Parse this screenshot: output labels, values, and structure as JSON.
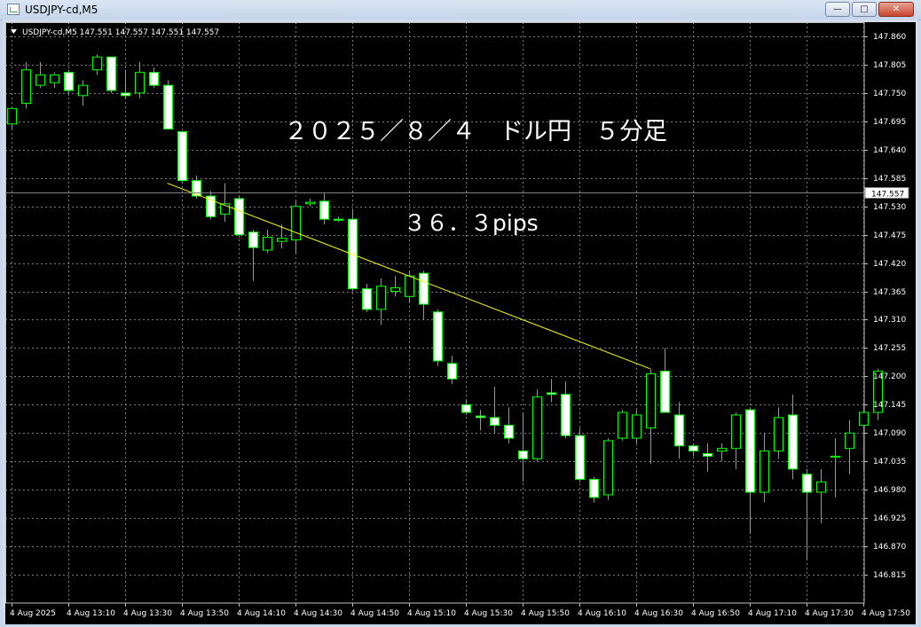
{
  "window": {
    "title": "USDJPY-cd,M5",
    "minimize_glyph": "—",
    "maximize_glyph": "□",
    "close_glyph": "✕"
  },
  "chart_header": "USDJPY-cd,M5  147.551 147.557 147.551 147.557",
  "colors": {
    "background": "#000000",
    "grid": "#7a7a7a",
    "axis_text": "#ffffff",
    "bull_candle_body": "#000000",
    "bull_candle_border": "#00ff00",
    "bear_candle_body": "#ffffff",
    "wick": "#00ff00",
    "trendline": "#ffff00",
    "bid_line": "#808080"
  },
  "annotation": {
    "title": "２０２５／８／４　ドル円　５分足",
    "pips": "３６．３pips"
  },
  "chart_data": {
    "type": "candlestick",
    "symbol": "USDJPY-cd",
    "timeframe": "M5",
    "grid": true,
    "ylim": [
      146.79,
      147.875
    ],
    "y_ticks": [
      "147.860",
      "147.805",
      "147.750",
      "147.695",
      "147.640",
      "147.585",
      "147.530",
      "147.475",
      "147.420",
      "147.365",
      "147.310",
      "147.255",
      "147.200",
      "147.145",
      "147.090",
      "147.035",
      "146.980",
      "146.925",
      "146.870",
      "146.815"
    ],
    "x_tick_labels": [
      "4 Aug 2025",
      "4 Aug 13:10",
      "4 Aug 13:30",
      "4 Aug 13:50",
      "4 Aug 14:10",
      "4 Aug 14:30",
      "4 Aug 14:50",
      "4 Aug 15:10",
      "4 Aug 15:30",
      "4 Aug 15:50",
      "4 Aug 16:10",
      "4 Aug 16:30",
      "4 Aug 16:50",
      "4 Aug 17:10",
      "4 Aug 17:30",
      "4 Aug 17:50"
    ],
    "current_price": "147.557",
    "trendline": {
      "from": [
        11,
        147.575
      ],
      "to": [
        45,
        147.215
      ]
    },
    "candles": [
      {
        "o": 147.69,
        "h": 147.72,
        "l": 147.68,
        "c": 147.72
      },
      {
        "o": 147.73,
        "h": 147.81,
        "l": 147.72,
        "c": 147.795
      },
      {
        "o": 147.765,
        "h": 147.81,
        "l": 147.76,
        "c": 147.785
      },
      {
        "o": 147.77,
        "h": 147.79,
        "l": 147.76,
        "c": 147.785
      },
      {
        "o": 147.79,
        "h": 147.795,
        "l": 147.745,
        "c": 147.755
      },
      {
        "o": 147.745,
        "h": 147.775,
        "l": 147.725,
        "c": 147.765
      },
      {
        "o": 147.795,
        "h": 147.825,
        "l": 147.785,
        "c": 147.82
      },
      {
        "o": 147.82,
        "h": 147.82,
        "l": 147.75,
        "c": 147.755
      },
      {
        "o": 147.75,
        "h": 147.795,
        "l": 147.74,
        "c": 147.745
      },
      {
        "o": 147.75,
        "h": 147.81,
        "l": 147.74,
        "c": 147.79
      },
      {
        "o": 147.79,
        "h": 147.8,
        "l": 147.76,
        "c": 147.765
      },
      {
        "o": 147.765,
        "h": 147.775,
        "l": 147.68,
        "c": 147.68
      },
      {
        "o": 147.675,
        "h": 147.675,
        "l": 147.575,
        "c": 147.58
      },
      {
        "o": 147.58,
        "h": 147.59,
        "l": 147.545,
        "c": 147.55
      },
      {
        "o": 147.55,
        "h": 147.56,
        "l": 147.505,
        "c": 147.51
      },
      {
        "o": 147.515,
        "h": 147.575,
        "l": 147.5,
        "c": 147.535
      },
      {
        "o": 147.545,
        "h": 147.55,
        "l": 147.47,
        "c": 147.475
      },
      {
        "o": 147.48,
        "h": 147.485,
        "l": 147.385,
        "c": 147.45
      },
      {
        "o": 147.445,
        "h": 147.485,
        "l": 147.44,
        "c": 147.47
      },
      {
        "o": 147.462,
        "h": 147.495,
        "l": 147.448,
        "c": 147.468
      },
      {
        "o": 147.465,
        "h": 147.54,
        "l": 147.44,
        "c": 147.53
      },
      {
        "o": 147.535,
        "h": 147.545,
        "l": 147.53,
        "c": 147.538
      },
      {
        "o": 147.54,
        "h": 147.555,
        "l": 147.495,
        "c": 147.505
      },
      {
        "o": 147.505,
        "h": 147.51,
        "l": 147.5,
        "c": 147.503
      },
      {
        "o": 147.505,
        "h": 147.525,
        "l": 147.365,
        "c": 147.37
      },
      {
        "o": 147.37,
        "h": 147.38,
        "l": 147.325,
        "c": 147.33
      },
      {
        "o": 147.33,
        "h": 147.39,
        "l": 147.3,
        "c": 147.375
      },
      {
        "o": 147.365,
        "h": 147.395,
        "l": 147.355,
        "c": 147.372
      },
      {
        "o": 147.355,
        "h": 147.405,
        "l": 147.345,
        "c": 147.395
      },
      {
        "o": 147.4,
        "h": 147.405,
        "l": 147.31,
        "c": 147.34
      },
      {
        "o": 147.325,
        "h": 147.33,
        "l": 147.22,
        "c": 147.23
      },
      {
        "o": 147.225,
        "h": 147.24,
        "l": 147.185,
        "c": 147.195
      },
      {
        "o": 147.145,
        "h": 147.155,
        "l": 147.125,
        "c": 147.13
      },
      {
        "o": 147.123,
        "h": 147.135,
        "l": 147.095,
        "c": 147.12
      },
      {
        "o": 147.12,
        "h": 147.18,
        "l": 147.09,
        "c": 147.105
      },
      {
        "o": 147.105,
        "h": 147.14,
        "l": 147.07,
        "c": 147.08
      },
      {
        "o": 147.055,
        "h": 147.13,
        "l": 146.995,
        "c": 147.04
      },
      {
        "o": 147.04,
        "h": 147.175,
        "l": 147.035,
        "c": 147.16
      },
      {
        "o": 147.168,
        "h": 147.195,
        "l": 147.15,
        "c": 147.165
      },
      {
        "o": 147.165,
        "h": 147.19,
        "l": 147.08,
        "c": 147.085
      },
      {
        "o": 147.085,
        "h": 147.1,
        "l": 146.995,
        "c": 147.0
      },
      {
        "o": 147.0,
        "h": 147.005,
        "l": 146.955,
        "c": 146.965
      },
      {
        "o": 146.97,
        "h": 147.08,
        "l": 146.96,
        "c": 147.075
      },
      {
        "o": 147.08,
        "h": 147.135,
        "l": 147.075,
        "c": 147.13
      },
      {
        "o": 147.08,
        "h": 147.135,
        "l": 147.07,
        "c": 147.125
      },
      {
        "o": 147.1,
        "h": 147.215,
        "l": 147.03,
        "c": 147.205
      },
      {
        "o": 147.21,
        "h": 147.255,
        "l": 147.13,
        "c": 147.13
      },
      {
        "o": 147.125,
        "h": 147.15,
        "l": 147.04,
        "c": 147.065
      },
      {
        "o": 147.065,
        "h": 147.07,
        "l": 147.045,
        "c": 147.055
      },
      {
        "o": 147.05,
        "h": 147.07,
        "l": 147.015,
        "c": 147.045
      },
      {
        "o": 147.055,
        "h": 147.07,
        "l": 147.035,
        "c": 147.06
      },
      {
        "o": 147.06,
        "h": 147.13,
        "l": 147.02,
        "c": 147.125
      },
      {
        "o": 147.135,
        "h": 147.14,
        "l": 146.895,
        "c": 146.975
      },
      {
        "o": 146.975,
        "h": 147.09,
        "l": 146.955,
        "c": 147.055
      },
      {
        "o": 147.055,
        "h": 147.14,
        "l": 147.04,
        "c": 147.12
      },
      {
        "o": 147.125,
        "h": 147.165,
        "l": 147.0,
        "c": 147.02
      },
      {
        "o": 147.01,
        "h": 147.02,
        "l": 146.845,
        "c": 146.975
      },
      {
        "o": 146.975,
        "h": 147.02,
        "l": 146.915,
        "c": 146.995
      },
      {
        "o": 147.045,
        "h": 147.08,
        "l": 146.965,
        "c": 147.045
      },
      {
        "o": 147.06,
        "h": 147.115,
        "l": 147.01,
        "c": 147.09
      },
      {
        "o": 147.105,
        "h": 147.15,
        "l": 147.02,
        "c": 147.13
      },
      {
        "o": 147.13,
        "h": 147.215,
        "l": 147.115,
        "c": 147.21
      }
    ]
  }
}
